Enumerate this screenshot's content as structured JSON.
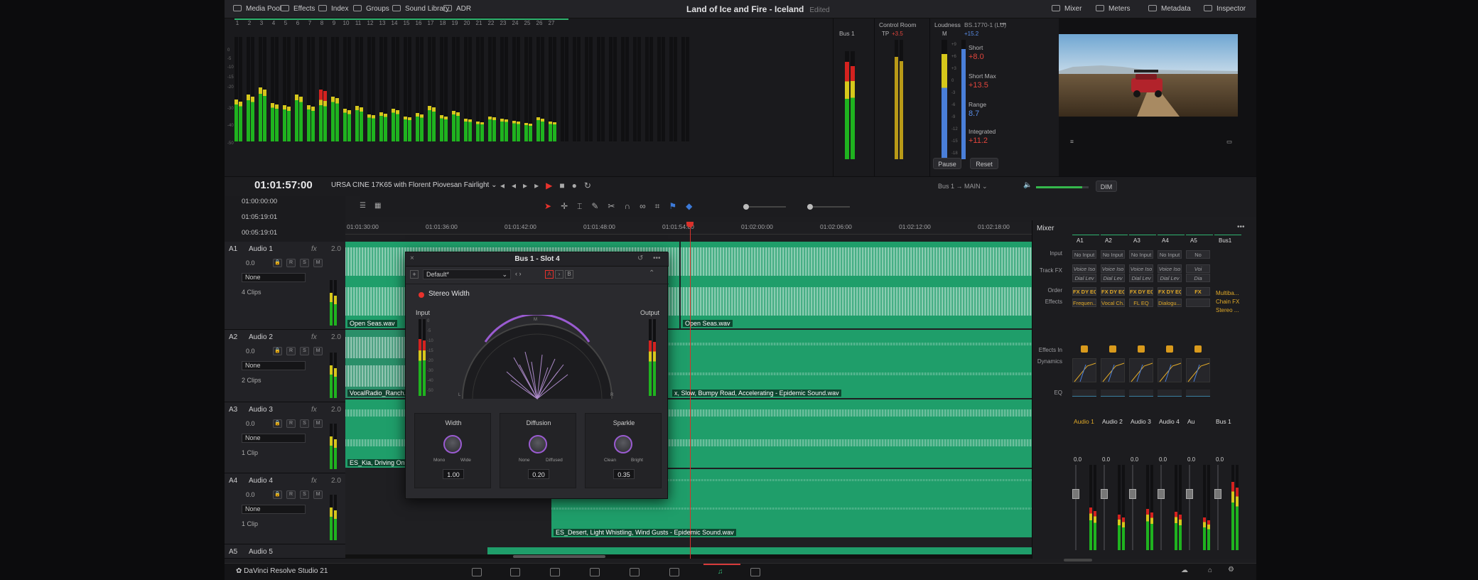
{
  "topbar": {
    "left_items": [
      {
        "label": "Media Pool",
        "icon": "media-pool-icon"
      },
      {
        "label": "Effects",
        "icon": "effects-icon"
      },
      {
        "label": "Index",
        "icon": "index-icon"
      },
      {
        "label": "Groups",
        "icon": "groups-icon"
      },
      {
        "label": "Sound Library",
        "icon": "sound-library-icon"
      },
      {
        "label": "ADR",
        "icon": "adr-icon"
      }
    ],
    "project_title": "Land of Ice and Fire - Iceland",
    "project_status": "Edited",
    "right_items": [
      {
        "label": "Mixer",
        "icon": "mixer-icon"
      },
      {
        "label": "Meters",
        "icon": "meters-icon"
      },
      {
        "label": "Metadata",
        "icon": "metadata-icon"
      },
      {
        "label": "Inspector",
        "icon": "inspector-icon"
      }
    ]
  },
  "meters": {
    "channels": [
      "1",
      "2",
      "3",
      "4",
      "5",
      "6",
      "7",
      "8",
      "9",
      "10",
      "11",
      "12",
      "13",
      "14",
      "15",
      "16",
      "17",
      "18",
      "19",
      "20",
      "21",
      "22",
      "23",
      "24",
      "25",
      "26",
      "27"
    ],
    "scale": [
      "0",
      "-5",
      "-10",
      "-15",
      "-20",
      "-30",
      "-40",
      "-50"
    ],
    "levels": [
      0.4,
      0.45,
      0.52,
      0.37,
      0.35,
      0.45,
      0.35,
      0.5,
      0.43,
      0.31,
      0.34,
      0.26,
      0.28,
      0.31,
      0.24,
      0.27,
      0.34,
      0.25,
      0.29,
      0.22,
      0.19,
      0.24,
      0.22,
      0.2,
      0.18,
      0.23,
      0.19
    ],
    "bus": {
      "label": "Bus 1"
    },
    "control_room": {
      "label": "Control Room",
      "tp_label": "TP",
      "tp_value": "+3.5",
      "scale": [
        "0",
        "-5",
        "-10",
        "-15",
        "-20",
        "-30",
        "-40",
        "-50"
      ]
    },
    "loudness": {
      "label": "Loudness",
      "standard": "BS.1770-1 (LU)",
      "m_label": "M",
      "m_value": "+15.2",
      "scale": [
        "+9",
        "+6",
        "+3",
        "0",
        "-3",
        "-6",
        "-9",
        "-12",
        "-15",
        "-18"
      ],
      "short_label": "Short",
      "short_value": "+8.0",
      "short_max_label": "Short Max",
      "short_max_value": "+13.5",
      "range_label": "Range",
      "range_value": "8.7",
      "integrated_label": "Integrated",
      "integrated_value": "+11.2",
      "pause_label": "Pause",
      "reset_label": "Reset"
    },
    "colors": {
      "green": "#1fb31f",
      "yellow": "#d6c81b",
      "red": "#d4221f",
      "blue": "#4a7fd9",
      "short_red": "#e2453c",
      "range_blue": "#5a8ee8"
    }
  },
  "transport": {
    "timecode": "01:01:57:00",
    "timeline_name": "URSA CINE 17K65 with Florent Piovesan Fairlight",
    "bus_route_from": "Bus 1",
    "bus_route_to": "MAIN",
    "dim_label": "DIM",
    "volume": 0.88
  },
  "timecodes": [
    "01:00:00:00",
    "01:05:19:01",
    "00:05:19:01"
  ],
  "ruler_ticks": [
    "01:01:30:00",
    "01:01:36:00",
    "01:01:42:00",
    "01:01:48:00",
    "01:01:54:00",
    "01:02:00:00",
    "01:02:06:00",
    "01:02:12:00",
    "01:02:18:00"
  ],
  "tracks": [
    {
      "id": "A1",
      "name": "Audio 1",
      "fx": "fx",
      "ch": "2.0",
      "level": "0.0",
      "preset": "None",
      "clips": "4 Clips"
    },
    {
      "id": "A2",
      "name": "Audio 2",
      "fx": "fx",
      "ch": "2.0",
      "level": "0.0",
      "preset": "None",
      "clips": "2 Clips"
    },
    {
      "id": "A3",
      "name": "Audio 3",
      "fx": "fx",
      "ch": "2.0",
      "level": "0.0",
      "preset": "None",
      "clips": "1 Clip"
    },
    {
      "id": "A4",
      "name": "Audio 4",
      "fx": "fx",
      "ch": "2.0",
      "level": "0.0",
      "preset": "None",
      "clips": "1 Clip"
    },
    {
      "id": "A5",
      "name": "Audio 5"
    }
  ],
  "clip_labels": {
    "a1_left": "Open Seas.wav",
    "a1_right": "Open Seas.wav",
    "a2_left": "VocalRadio_Ranch.wav",
    "a2_right": "x, Slow, Bumpy Road, Accelerating - Epidemic Sound.wav",
    "a3": "ES_Kia, Driving On Sand",
    "a4": "ES_Desert, Light Whistling, Wind Gusts - Epidemic Sound.wav"
  },
  "plugin": {
    "title": "Bus 1 - Slot 4",
    "preset": "Default*",
    "ab_a": "A",
    "ab_b": "B",
    "name": "Stereo Width",
    "input_label": "Input",
    "output_label": "Output",
    "m_label": "M",
    "l_label": "L",
    "r_label": "R",
    "scale": [
      "0",
      "-5",
      "-10",
      "-15",
      "-20",
      "-30",
      "-40",
      "-50"
    ],
    "controls": [
      {
        "name": "Width",
        "lo": "Mono",
        "hi": "Wide",
        "value": "1.00"
      },
      {
        "name": "Diffusion",
        "lo": "None",
        "hi": "Diffused",
        "value": "0.20"
      },
      {
        "name": "Sparkle",
        "lo": "Clean",
        "hi": "Bright",
        "value": "0.35"
      }
    ]
  },
  "mixer": {
    "title": "Mixer",
    "columns": [
      "A1",
      "A2",
      "A3",
      "A4",
      "A5",
      "Bus1"
    ],
    "row_labels": [
      "Input",
      "Track FX",
      "Order",
      "Effects",
      "Effects In",
      "Dynamics",
      "EQ"
    ],
    "input": [
      "No Input",
      "No Input",
      "No Input",
      "No Input",
      "No"
    ],
    "trackfx": [
      "Voice Iso",
      "Voice Iso",
      "Voice Iso",
      "Voice Iso",
      "Voi"
    ],
    "trackfx2": [
      "Dial Lev",
      "Dial Lev",
      "Dial Lev",
      "Dial Lev",
      "Dia"
    ],
    "order": [
      "FX DY EQ",
      "FX DY EQ",
      "FX DY EQ",
      "FX DY EQ",
      "FX"
    ],
    "effects": [
      "Frequen...",
      "Vocal Ch...",
      "FL EQ",
      "Dialogu...",
      ""
    ],
    "bus_effects": [
      "Multiba...",
      "Chain FX",
      "Stereo ..."
    ],
    "strip_names": [
      "Audio 1",
      "Audio 2",
      "Audio 3",
      "Audio 4",
      "Au",
      "Bus 1"
    ],
    "levels": [
      "0.0",
      "0.0",
      "0.0",
      "0.0",
      "0.0",
      "0.0"
    ],
    "strip_meter": [
      0.5,
      0.42,
      0.48,
      0.45,
      0.38,
      0.8
    ]
  },
  "footer": {
    "app_name": "DaVinci Resolve Studio 21"
  }
}
